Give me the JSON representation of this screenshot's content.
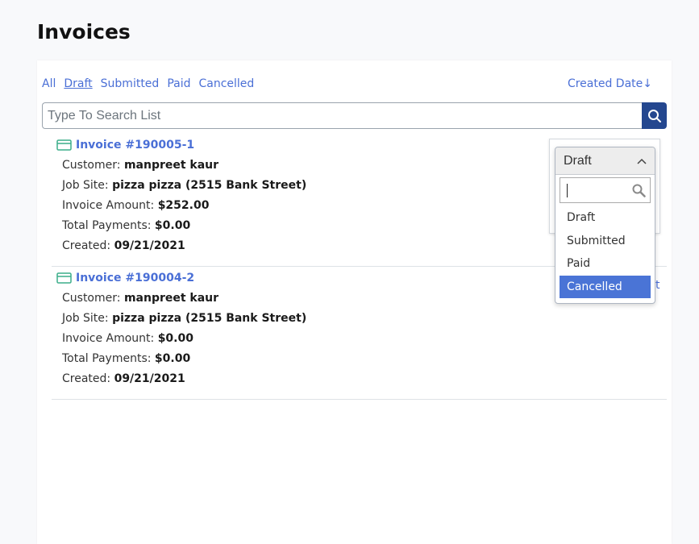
{
  "page": {
    "title": "Invoices"
  },
  "filters": {
    "items": [
      {
        "label": "All",
        "active": false
      },
      {
        "label": "Draft",
        "active": true
      },
      {
        "label": "Submitted",
        "active": false
      },
      {
        "label": "Paid",
        "active": false
      },
      {
        "label": "Cancelled",
        "active": false
      }
    ],
    "sort_label": "Created Date↓"
  },
  "search": {
    "placeholder": "Type To Search List",
    "value": ""
  },
  "labels": {
    "customer": "Customer: ",
    "job_site": "Job Site: ",
    "invoice_amount": "Invoice Amount: ",
    "total_payments": "Total Payments: ",
    "created": "Created: "
  },
  "invoices": [
    {
      "title": "Invoice #190005-1",
      "customer": "manpreet kaur",
      "job_site": "pizza pizza (2515 Bank Street)",
      "invoice_amount": "$252.00",
      "total_payments": "$0.00",
      "created": "09/21/2021"
    },
    {
      "title": "Invoice #190004-2",
      "customer": "manpreet kaur",
      "job_site": "pizza pizza (2515 Bank Street)",
      "invoice_amount": "$0.00",
      "total_payments": "$0.00",
      "created": "09/21/2021",
      "partial_right_text": "t"
    }
  ],
  "status_dropdown": {
    "selected": "Draft",
    "search_value": "",
    "options": [
      "Draft",
      "Submitted",
      "Paid",
      "Cancelled"
    ],
    "highlighted": "Cancelled"
  },
  "colors": {
    "accent": "#4a6fd6",
    "search_button": "#24478f",
    "highlight": "#4a74d6",
    "card_icon": "#3cae8a"
  },
  "icons": {
    "search_button": "search-icon",
    "invoice": "credit-card-icon",
    "dropdown_toggle": "chevron-up-icon",
    "dropdown_search": "magnifier-icon"
  }
}
